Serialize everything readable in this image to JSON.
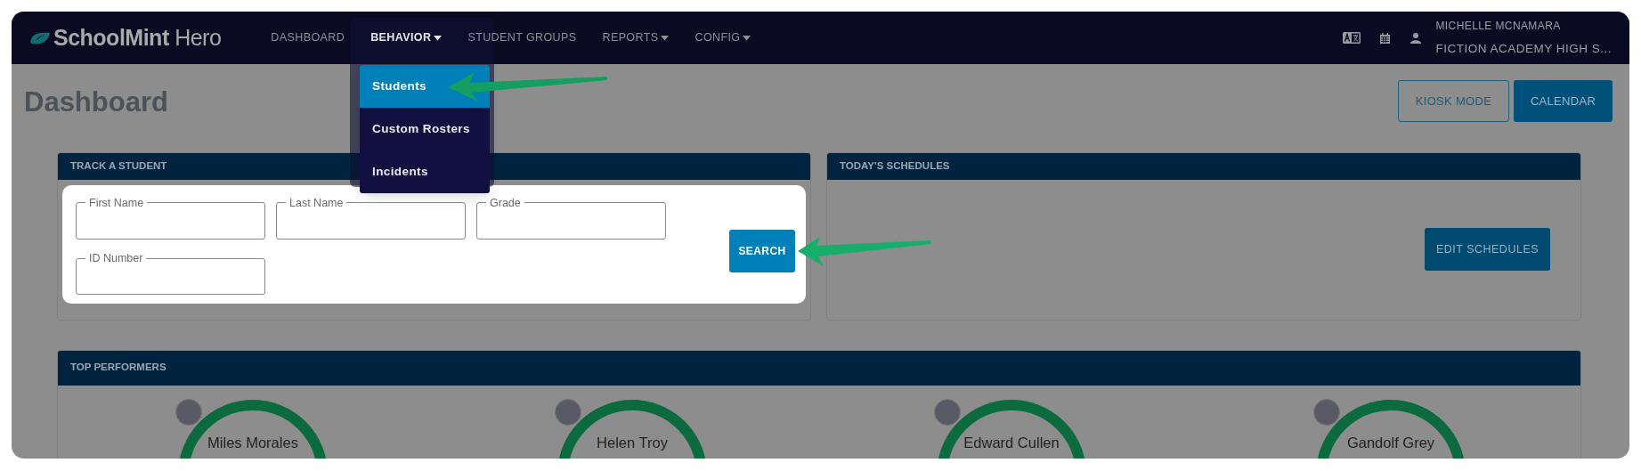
{
  "brand": {
    "name": "SchoolMint",
    "suffix": "Hero"
  },
  "nav": [
    {
      "label": "DASHBOARD",
      "dropdown": false,
      "selected": false
    },
    {
      "label": "BEHAVIOR",
      "dropdown": true,
      "selected": true
    },
    {
      "label": "STUDENT GROUPS",
      "dropdown": false,
      "selected": false
    },
    {
      "label": "REPORTS",
      "dropdown": true,
      "selected": false
    },
    {
      "label": "CONFIG",
      "dropdown": true,
      "selected": false
    }
  ],
  "behavior_menu": [
    {
      "label": "Students",
      "selected": true
    },
    {
      "label": "Custom Rosters",
      "selected": false
    },
    {
      "label": "Incidents",
      "selected": false
    }
  ],
  "user": {
    "name": "MICHELLE MCNAMARA",
    "school": "FICTION ACADEMY HIGH S..."
  },
  "page_title": "Dashboard",
  "header_buttons": [
    {
      "label": "KIOSK MODE",
      "kind": "outline"
    },
    {
      "label": "CALENDAR",
      "kind": "solid"
    }
  ],
  "track_student": {
    "title": "TRACK A STUDENT",
    "fields": [
      {
        "label": "First Name"
      },
      {
        "label": "Last Name"
      },
      {
        "label": "Grade"
      },
      {
        "label": "ID Number"
      }
    ],
    "search_button": "SEARCH"
  },
  "schedules": {
    "title": "TODAY'S SCHEDULES",
    "button": "EDIT SCHEDULES"
  },
  "top_performers": {
    "title": "TOP PERFORMERS",
    "students": [
      {
        "name": "Miles Morales"
      },
      {
        "name": "Helen Troy"
      },
      {
        "name": "Edward Cullen"
      },
      {
        "name": "Gandolf Grey"
      }
    ]
  }
}
